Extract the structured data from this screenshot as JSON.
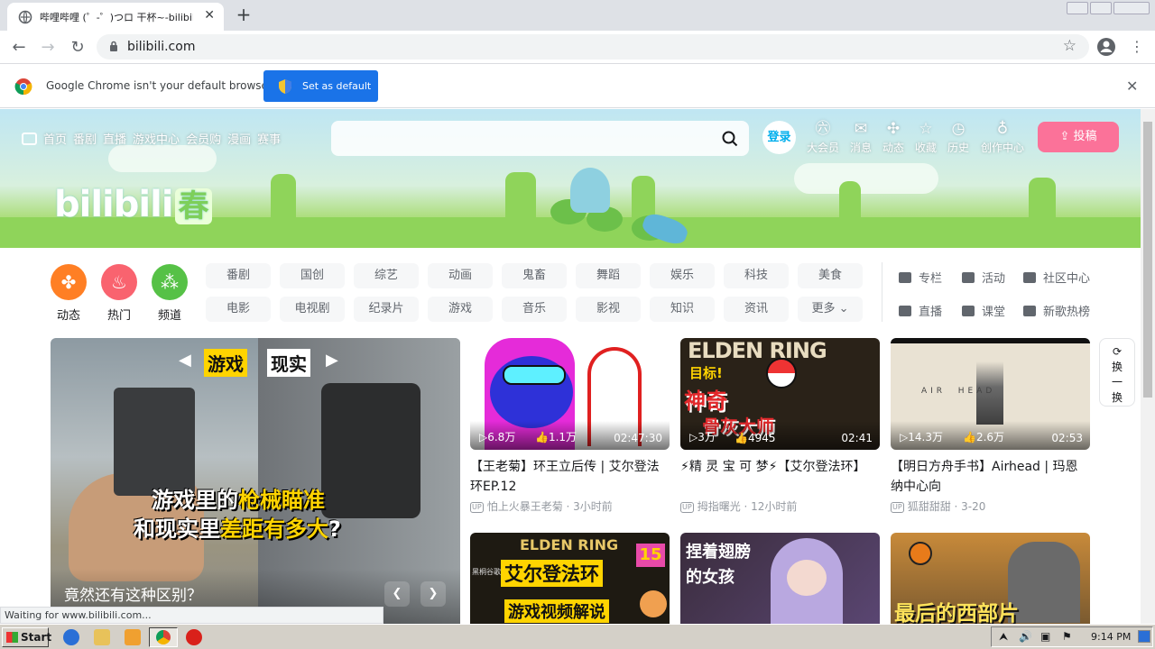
{
  "browser": {
    "tab_title": "哔哩哔哩 (゜-゜)つロ 干杯~-bilibili",
    "url": "bilibili.com",
    "infobar_text": "Google Chrome isn't your default browser",
    "set_default_label": "Set as default",
    "status_text": "Waiting for www.bilibili.com..."
  },
  "header": {
    "nav": [
      "首页",
      "番剧",
      "直播",
      "游戏中心",
      "会员购",
      "漫画",
      "赛事"
    ],
    "login_label": "登录",
    "icons": [
      {
        "label": "大会员",
        "icon": "vip-icon"
      },
      {
        "label": "消息",
        "icon": "message-icon"
      },
      {
        "label": "动态",
        "icon": "dynamic-icon"
      },
      {
        "label": "收藏",
        "icon": "favorite-icon"
      },
      {
        "label": "历史",
        "icon": "history-icon"
      },
      {
        "label": "创作中心",
        "icon": "creator-icon"
      }
    ],
    "upload_label": "投稿",
    "logo_text": "bilibili",
    "logo_season": "春"
  },
  "channels": [
    {
      "label": "动态",
      "color": "#ff7f24"
    },
    {
      "label": "热门",
      "color": "#f9636f"
    },
    {
      "label": "频道",
      "color": "#56c146"
    }
  ],
  "categories_row1": [
    "番剧",
    "国创",
    "综艺",
    "动画",
    "鬼畜",
    "舞蹈",
    "娱乐",
    "科技",
    "美食"
  ],
  "categories_row2": [
    "电影",
    "电视剧",
    "纪录片",
    "游戏",
    "音乐",
    "影视",
    "知识",
    "资讯",
    "更多"
  ],
  "side_links": [
    [
      "专栏",
      "活动",
      "社区中心"
    ],
    [
      "直播",
      "课堂",
      "新歌热榜"
    ]
  ],
  "hero": {
    "tag1": "游戏",
    "tag2": "现实",
    "line1a": "游戏里的",
    "line1b": "枪械瞄准",
    "line2a": "和现实里",
    "line2b": "差距有多大",
    "line2c": "?",
    "caption": "竟然还有这种区别？"
  },
  "cards": [
    {
      "views": "6.8万",
      "likes": "1.1万",
      "duration": "02:47:30",
      "title": "【王老菊】环王立后传 | 艾尔登法环EP.12",
      "uploader": "怕上火暴王老菊",
      "time": "3小时前"
    },
    {
      "views": "3万",
      "likes": "4945",
      "duration": "02:41",
      "title": "⚡精 灵 宝 可 梦⚡【艾尔登法环】",
      "uploader": "拇指曙光",
      "time": "12小时前"
    },
    {
      "views": "14.3万",
      "likes": "2.6万",
      "duration": "02:53",
      "title": "【明日方舟手书】Airhead | 玛恩纳中心向",
      "uploader": "狐甜甜甜",
      "time": "3-20"
    }
  ],
  "card_text": {
    "elden": "ELDEN RING",
    "goal": "目标!",
    "god": "神奇",
    "master": "骨灰大师",
    "airhead": "AIR  HEAD",
    "elden2": "ELDEN RING",
    "elden_cn": "艾尔登法环",
    "elden_num": "15",
    "elden_sub": "游戏视频解说",
    "elden_by": "黑桐谷歌",
    "art_text": "捏着翅膀的女孩",
    "west": "最后的西部片"
  },
  "refresh": {
    "line1": "换",
    "line2": "一",
    "line3": "换"
  },
  "taskbar": {
    "start": "Start",
    "clock": "9:14 PM"
  }
}
